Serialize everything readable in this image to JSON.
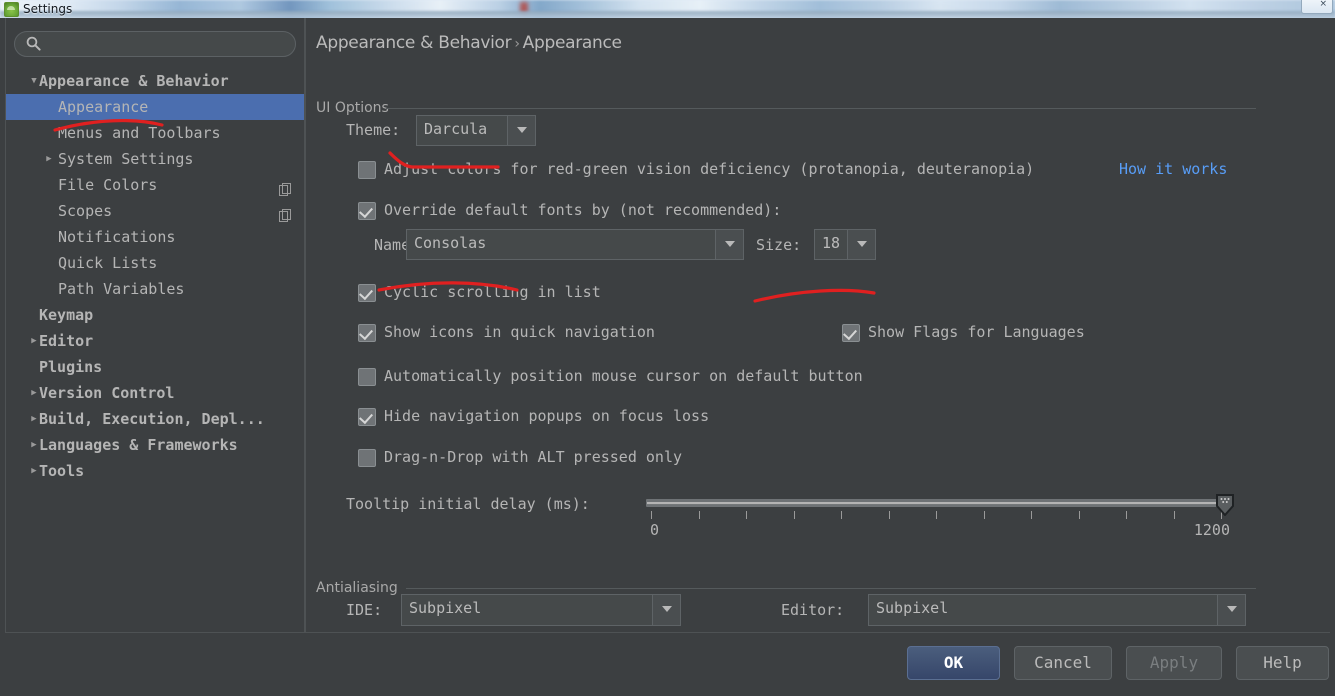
{
  "window": {
    "title": "Settings",
    "app_icon": "android-studio-icon",
    "close_label": "×"
  },
  "sidebar": {
    "search": {
      "placeholder": "",
      "value": "",
      "icon": "search-icon"
    },
    "items": [
      {
        "label": "Appearance & Behavior",
        "level": 0,
        "arrow": "▼",
        "selected": false,
        "copy_icon": false
      },
      {
        "label": "Appearance",
        "level": 1,
        "arrow": "",
        "selected": true,
        "copy_icon": false
      },
      {
        "label": "Menus and Toolbars",
        "level": 1,
        "arrow": "",
        "selected": false,
        "copy_icon": false
      },
      {
        "label": "System Settings",
        "level": 1,
        "arrow": "▶",
        "selected": false,
        "copy_icon": false
      },
      {
        "label": "File Colors",
        "level": 1,
        "arrow": "",
        "selected": false,
        "copy_icon": true
      },
      {
        "label": "Scopes",
        "level": 1,
        "arrow": "",
        "selected": false,
        "copy_icon": true
      },
      {
        "label": "Notifications",
        "level": 1,
        "arrow": "",
        "selected": false,
        "copy_icon": false
      },
      {
        "label": "Quick Lists",
        "level": 1,
        "arrow": "",
        "selected": false,
        "copy_icon": false
      },
      {
        "label": "Path Variables",
        "level": 1,
        "arrow": "",
        "selected": false,
        "copy_icon": false
      },
      {
        "label": "Keymap",
        "level": 0,
        "arrow": "",
        "selected": false,
        "copy_icon": false
      },
      {
        "label": "Editor",
        "level": 0,
        "arrow": "▶",
        "selected": false,
        "copy_icon": false
      },
      {
        "label": "Plugins",
        "level": 0,
        "arrow": "",
        "selected": false,
        "copy_icon": false
      },
      {
        "label": "Version Control",
        "level": 0,
        "arrow": "▶",
        "selected": false,
        "copy_icon": false
      },
      {
        "label": "Build, Execution, Depl...",
        "level": 0,
        "arrow": "▶",
        "selected": false,
        "copy_icon": false
      },
      {
        "label": "Languages & Frameworks",
        "level": 0,
        "arrow": "▶",
        "selected": false,
        "copy_icon": false
      },
      {
        "label": "Tools",
        "level": 0,
        "arrow": "▶",
        "selected": false,
        "copy_icon": false
      }
    ]
  },
  "content": {
    "breadcrumb": {
      "parent": "Appearance & Behavior",
      "separator": "›",
      "current": "Appearance"
    },
    "ui_options": {
      "group_title": "UI Options",
      "theme_label": "Theme:",
      "theme_value": "Darcula",
      "adjust_colors_label": "Adjust colors for red-green vision deficiency (protanopia, deuteranopia)",
      "adjust_colors_checked": false,
      "how_it_works_link": "How it works",
      "override_fonts_label": "Override default fonts by (not recommended):",
      "override_fonts_checked": true,
      "font_name_label": "Name:",
      "font_name_value": "Consolas",
      "font_size_label": "Size:",
      "font_size_value": "18",
      "cyclic_scrolling_label": "Cyclic scrolling in list",
      "cyclic_scrolling_checked": true,
      "show_icons_label": "Show icons in quick navigation",
      "show_icons_checked": true,
      "show_flags_label": "Show Flags for Languages",
      "show_flags_checked": true,
      "auto_position_label": "Automatically position mouse cursor on default button",
      "auto_position_checked": false,
      "hide_popups_label": "Hide navigation popups on focus loss",
      "hide_popups_checked": true,
      "drag_drop_label": "Drag-n-Drop with ALT pressed only",
      "drag_drop_checked": false,
      "tooltip_delay_label": "Tooltip initial delay (ms):",
      "tooltip_delay_min": "0",
      "tooltip_delay_max": "1200",
      "tooltip_delay_value": "1200",
      "tooltip_tick_count": 13
    },
    "antialiasing": {
      "group_title": "Antialiasing",
      "ide_label": "IDE:",
      "ide_value": "Subpixel",
      "editor_label": "Editor:",
      "editor_value": "Subpixel"
    }
  },
  "buttons": {
    "ok": "OK",
    "cancel": "Cancel",
    "apply": "Apply",
    "help": "Help"
  },
  "colors": {
    "background": "#3c3f41",
    "selection": "#4b6eaf",
    "link": "#589df6",
    "annotation": "#e02020",
    "text": "#b5b5b5"
  }
}
